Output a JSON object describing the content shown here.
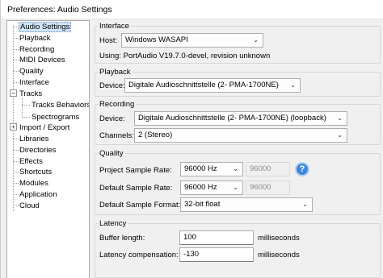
{
  "window": {
    "title": "Preferences: Audio Settings"
  },
  "tree": {
    "items": [
      {
        "label": "Audio Settings"
      },
      {
        "label": "Playback"
      },
      {
        "label": "Recording"
      },
      {
        "label": "MIDI Devices"
      },
      {
        "label": "Quality"
      },
      {
        "label": "Interface"
      },
      {
        "label": "Tracks"
      },
      {
        "label": "Tracks Behaviors"
      },
      {
        "label": "Spectrograms"
      },
      {
        "label": "Import / Export"
      },
      {
        "label": "Libraries"
      },
      {
        "label": "Directories"
      },
      {
        "label": "Effects"
      },
      {
        "label": "Shortcuts"
      },
      {
        "label": "Modules"
      },
      {
        "label": "Application"
      },
      {
        "label": "Cloud"
      }
    ],
    "expander_minus": "−",
    "expander_plus": "+"
  },
  "interface": {
    "group_label": "Interface",
    "host_label": "Host:",
    "host_value": "Windows WASAPI",
    "using_text": "Using: PortAudio V19.7.0-devel, revision unknown"
  },
  "playback": {
    "group_label": "Playback",
    "device_label": "Device:",
    "device_value": "Digitale Audioschnittstelle (2- PMA-1700NE)"
  },
  "recording": {
    "group_label": "Recording",
    "device_label": "Device:",
    "device_value": "Digitale Audioschnittstelle (2- PMA-1700NE) (loopback)",
    "channels_label": "Channels:",
    "channels_value": "2 (Stereo)"
  },
  "quality": {
    "group_label": "Quality",
    "project_rate_label": "Project Sample Rate:",
    "project_rate_value": "96000 Hz",
    "project_rate_custom": "96000",
    "default_rate_label": "Default Sample Rate:",
    "default_rate_value": "96000 Hz",
    "default_rate_custom": "96000",
    "default_format_label": "Default Sample Format:",
    "default_format_value": "32-bit float",
    "help_symbol": "?"
  },
  "latency": {
    "group_label": "Latency",
    "buffer_label": "Buffer length:",
    "buffer_value": "100",
    "buffer_unit": "milliseconds",
    "compensation_label": "Latency compensation:",
    "compensation_value": "-130",
    "compensation_unit": "milliseconds"
  },
  "icons": {
    "dropdown": "chevron-down-icon",
    "help": "help-icon"
  },
  "colors": {
    "selection": "#cfe4fb",
    "help_accent": "#3f87d8"
  }
}
